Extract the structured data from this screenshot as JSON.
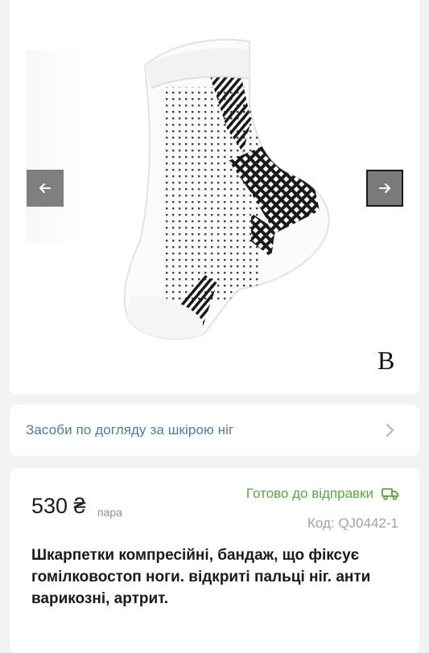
{
  "gallery": {
    "variant_letter": "B",
    "prev_icon": "arrow-left-icon",
    "next_icon": "arrow-right-icon"
  },
  "category": {
    "label": "Засоби по догляду за шкірою ніг",
    "icon": "chevron-right-icon"
  },
  "product": {
    "price": "530 ₴",
    "price_unit": "пара",
    "status": "Готово до відправки",
    "status_icon": "delivery-truck-icon",
    "code": "Код: QJ0442-1",
    "title": "Шкарпетки компресійні, бандаж, що фіксує гомілковостоп ноги. відкриті пальці ніг. анти варикозні, артрит."
  },
  "colors": {
    "page_bg": "#f2f3f5",
    "card_bg": "#ffffff",
    "status_green": "#5aa83a",
    "link_blue": "#4a7ea0",
    "muted_gray": "#9aa3ad"
  }
}
